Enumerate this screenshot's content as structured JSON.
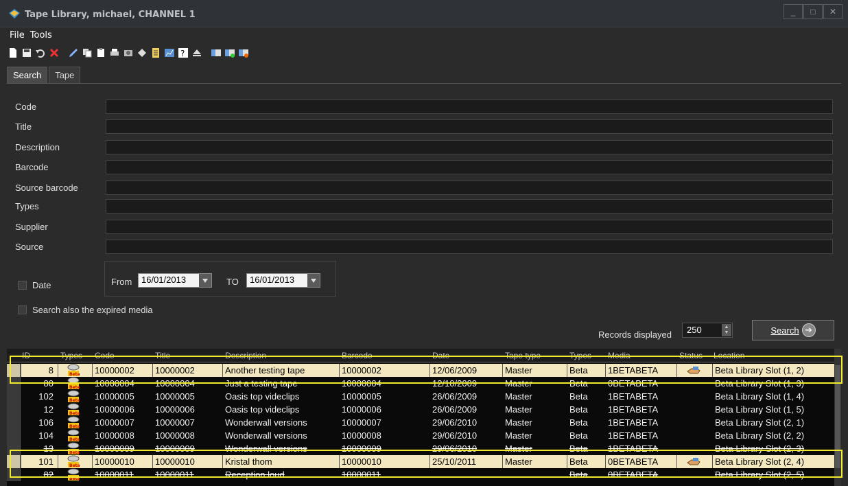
{
  "window": {
    "title": "Tape Library, michael, CHANNEL 1",
    "controls": [
      "_",
      "□",
      "✕"
    ]
  },
  "menu": [
    "File",
    "Tools"
  ],
  "toolbar_icons": [
    "new-icon",
    "save-icon",
    "undo-icon",
    "delete-icon",
    "edit-icon",
    "copy-icon",
    "paste-icon",
    "print-icon",
    "export-icon",
    "import-icon",
    "report-icon",
    "chart-icon",
    "help-icon",
    "eject-icon",
    "library-icon",
    "library-add-icon",
    "library-remove-icon"
  ],
  "tabs": [
    {
      "label": "Search",
      "active": true
    },
    {
      "label": "Tape",
      "active": false
    }
  ],
  "form": {
    "fields": [
      {
        "label": "Code",
        "value": ""
      },
      {
        "label": "Title",
        "value": ""
      },
      {
        "label": "Description",
        "value": ""
      },
      {
        "label": "Barcode",
        "value": ""
      },
      {
        "label": "Source barcode",
        "value": ""
      },
      {
        "label": "Types",
        "value": ""
      },
      {
        "label": "Supplier",
        "value": ""
      },
      {
        "label": "Source",
        "value": ""
      }
    ],
    "date_label": "Date",
    "from_label": "From",
    "from_value": "16/01/2013",
    "to_label": "TO",
    "to_value": "16/01/2013",
    "expired_label": "Search also the expired media",
    "records_label": "Records displayed",
    "records_value": "250",
    "search_button": "Search"
  },
  "grid": {
    "columns": [
      "ID",
      "Types",
      "Code",
      "Title",
      "Description",
      "Barcode",
      "Date",
      "Tape type",
      "Types",
      "Media",
      "Status",
      "Location"
    ],
    "rows": [
      {
        "id": "8",
        "code": "10000002",
        "title": "10000002",
        "description": "Another testing tape",
        "barcode": "10000002",
        "date": "12/06/2009",
        "tape_type": "Master",
        "types": "Beta",
        "media": "1BETABETA",
        "status": "out",
        "location": "Beta Library Slot (1, 2)",
        "selected": true,
        "strike": false
      },
      {
        "id": "80",
        "code": "10000004",
        "title": "10000004",
        "description": "Just a testing tape",
        "barcode": "10000004",
        "date": "12/10/2009",
        "tape_type": "Master",
        "types": "Beta",
        "media": "0BETABETA",
        "status": "",
        "location": "Beta Library Slot (1, 3)",
        "selected": false,
        "strike": true
      },
      {
        "id": "102",
        "code": "10000005",
        "title": "10000005",
        "description": "Oasis top videclips",
        "barcode": "10000005",
        "date": "26/06/2009",
        "tape_type": "Master",
        "types": "Beta",
        "media": "1BETABETA",
        "status": "",
        "location": "Beta Library Slot (1, 4)",
        "selected": false,
        "strike": false
      },
      {
        "id": "12",
        "code": "10000006",
        "title": "10000006",
        "description": "Oasis top videclips",
        "barcode": "10000006",
        "date": "26/06/2009",
        "tape_type": "Master",
        "types": "Beta",
        "media": "1BETABETA",
        "status": "",
        "location": "Beta Library Slot (1, 5)",
        "selected": false,
        "strike": false
      },
      {
        "id": "106",
        "code": "10000007",
        "title": "10000007",
        "description": "Wonderwall versions",
        "barcode": "10000007",
        "date": "29/06/2010",
        "tape_type": "Master",
        "types": "Beta",
        "media": "1BETABETA",
        "status": "",
        "location": "Beta Library Slot (2, 1)",
        "selected": false,
        "strike": false
      },
      {
        "id": "104",
        "code": "10000008",
        "title": "10000008",
        "description": "Wonderwall versions",
        "barcode": "10000008",
        "date": "29/06/2010",
        "tape_type": "Master",
        "types": "Beta",
        "media": "1BETABETA",
        "status": "",
        "location": "Beta Library Slot (2, 2)",
        "selected": false,
        "strike": false
      },
      {
        "id": "13",
        "code": "10000009",
        "title": "10000009",
        "description": "Wonderwall versions",
        "barcode": "10000009",
        "date": "29/06/2010",
        "tape_type": "Master",
        "types": "Beta",
        "media": "1BETABETA",
        "status": "",
        "location": "Beta Library Slot (2, 3)",
        "selected": false,
        "strike": true
      },
      {
        "id": "101",
        "code": "10000010",
        "title": "10000010",
        "description": "Kristal thom",
        "barcode": "10000010",
        "date": "25/10/2011",
        "tape_type": "Master",
        "types": "Beta",
        "media": "0BETABETA",
        "status": "out",
        "location": "Beta Library Slot (2, 4)",
        "selected": true,
        "strike": false
      },
      {
        "id": "82",
        "code": "10000011",
        "title": "10000011",
        "description": "Reception loud",
        "barcode": "10000011",
        "date": "",
        "tape_type": "",
        "types": "Beta",
        "media": "0BETABETA",
        "status": "",
        "location": "Beta Library Slot (2, 5)",
        "selected": false,
        "strike": true
      }
    ]
  },
  "colors": {
    "selected_row": "#f4e8c0",
    "highlight_box": "#f2ea2f",
    "background": "#2b2b2b",
    "grid_background": "#0a0a0a"
  }
}
